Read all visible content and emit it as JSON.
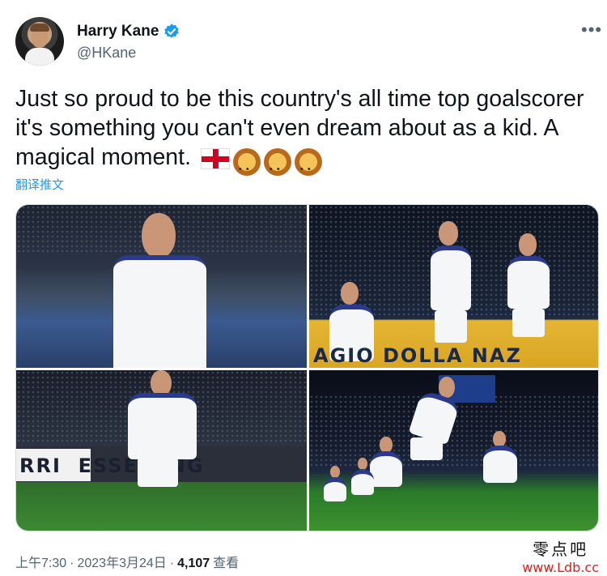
{
  "author": {
    "display_name": "Harry Kane",
    "handle": "@HKane",
    "verified": true
  },
  "tweet": {
    "text": "Just so proud to be this country's all time top goalscorer it's something you can't even dream about as a kid. A magical moment.",
    "emojis": [
      "england-flag-icon",
      "lion-icon",
      "lion-icon",
      "lion-icon"
    ],
    "translate_label": "翻译推文"
  },
  "media": {
    "photos": [
      {
        "name": "photo-1",
        "banner": ""
      },
      {
        "name": "photo-2",
        "banner": "AGIO DOLLA NAZ"
      },
      {
        "name": "photo-3",
        "banner": "RRI  ESSELUNG"
      },
      {
        "name": "photo-4",
        "banner": ""
      }
    ]
  },
  "footer": {
    "time": "上午7:30",
    "separator": "·",
    "date": "2023年3月24日",
    "separator2": "·",
    "views_count": "4,107",
    "views_label": "查看"
  },
  "watermark": {
    "chinese": "零点吧",
    "url": "www.Ldb.cc"
  },
  "colors": {
    "link": "#1d9bf0",
    "verified": "#1d9bf0",
    "secondary_text": "#536471"
  }
}
